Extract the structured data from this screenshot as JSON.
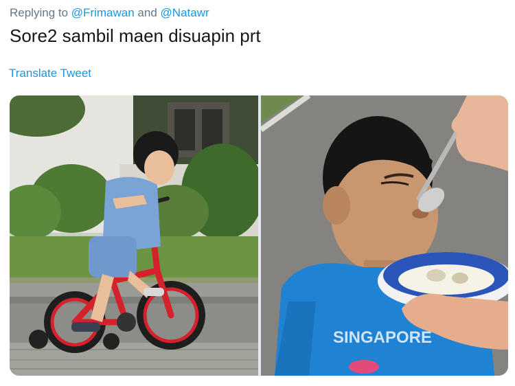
{
  "reply": {
    "prefix": "Replying to",
    "mention_1": "@Frimawan",
    "conjunction": "and",
    "mention_2": "@Natawr"
  },
  "tweet": {
    "text": "Sore2 sambil maen disuapin prt",
    "translate_label": "Translate Tweet"
  },
  "media": {
    "photos": [
      {
        "name": "boy-riding-red-bicycle"
      },
      {
        "name": "boy-being-spoon-fed"
      }
    ],
    "shirt_print": "SINGAPORE"
  }
}
